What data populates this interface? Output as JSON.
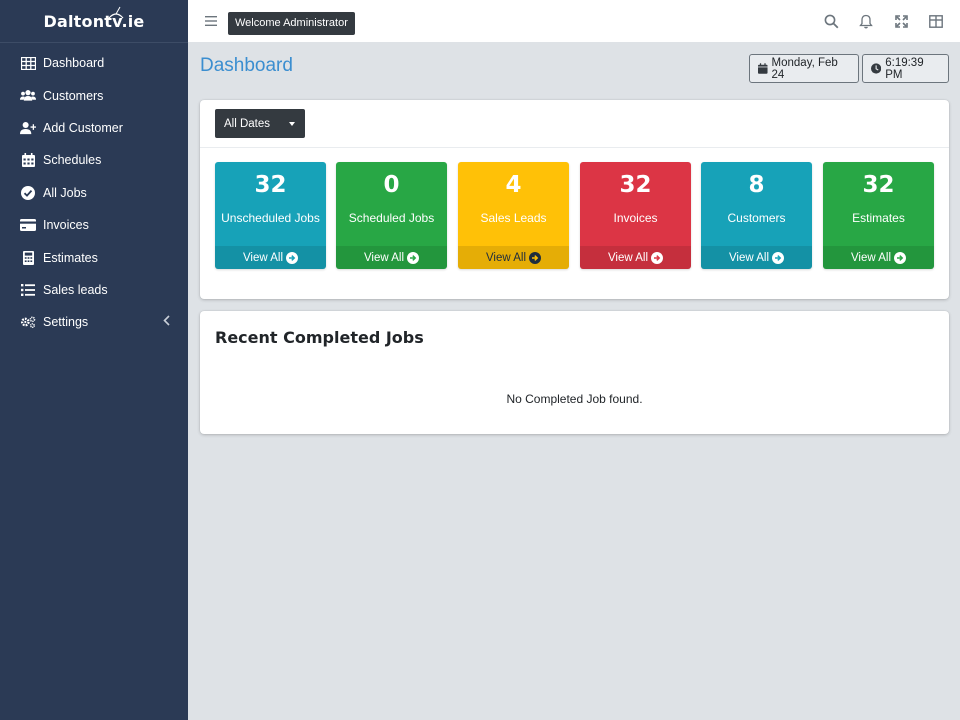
{
  "brand": {
    "name": "Daltontv.ie"
  },
  "sidebar": {
    "items": [
      {
        "label": "Dashboard",
        "icon": "table-icon"
      },
      {
        "label": "Customers",
        "icon": "users-icon"
      },
      {
        "label": "Add Customer",
        "icon": "user-plus-icon"
      },
      {
        "label": "Schedules",
        "icon": "calendar-icon"
      },
      {
        "label": "All Jobs",
        "icon": "check-circle-icon"
      },
      {
        "label": "Invoices",
        "icon": "credit-card-icon"
      },
      {
        "label": "Estimates",
        "icon": "calculator-icon"
      },
      {
        "label": "Sales leads",
        "icon": "list-icon"
      },
      {
        "label": "Settings",
        "icon": "cogs-icon"
      }
    ]
  },
  "topbar": {
    "welcome": "Welcome Administrator",
    "icons": [
      "search-icon",
      "bell-icon",
      "expand-icon",
      "grid-icon"
    ]
  },
  "header": {
    "title": "Dashboard",
    "date": "Monday, Feb 24",
    "time": "6:19:39 PM"
  },
  "filter": {
    "label": "All Dates"
  },
  "tiles": [
    {
      "value": "32",
      "label": "Unscheduled Jobs",
      "link": "View All",
      "color": "#17a2b8"
    },
    {
      "value": "0",
      "label": "Scheduled Jobs",
      "link": "View All",
      "color": "#28a745"
    },
    {
      "value": "4",
      "label": "Sales Leads",
      "link": "View All",
      "color": "#ffc107"
    },
    {
      "value": "32",
      "label": "Invoices",
      "link": "View All",
      "color": "#dc3545"
    },
    {
      "value": "8",
      "label": "Customers",
      "link": "View All",
      "color": "#17a2b8"
    },
    {
      "value": "32",
      "label": "Estimates",
      "link": "View All",
      "color": "#28a745"
    }
  ],
  "recent": {
    "title": "Recent Completed Jobs",
    "empty": "No Completed Job found."
  },
  "colors": {
    "sidebar": "#2b3a55",
    "accent": "#3b8ed0",
    "page_bg": "#dee2e6"
  }
}
